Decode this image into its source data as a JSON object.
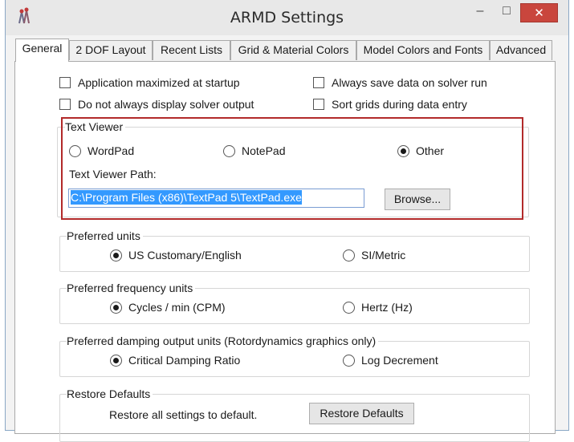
{
  "window": {
    "title": "ARMD Settings",
    "minimize_glyph": "–",
    "maximize_glyph": "□",
    "close_glyph": "✕"
  },
  "tabs": [
    {
      "label": "General",
      "active": true
    },
    {
      "label": "2 DOF Layout",
      "active": false
    },
    {
      "label": "Recent Lists",
      "active": false
    },
    {
      "label": "Grid & Material Colors",
      "active": false
    },
    {
      "label": "Model Colors and Fonts",
      "active": false
    },
    {
      "label": "Advanced",
      "active": false
    }
  ],
  "options": {
    "app_maximized": {
      "label": "Application maximized at startup",
      "checked": false
    },
    "always_save": {
      "label": "Always save data on solver run",
      "checked": false
    },
    "no_display_output": {
      "label": "Do not always display solver output",
      "checked": false
    },
    "sort_grids": {
      "label": "Sort grids during data entry",
      "checked": false
    }
  },
  "text_viewer": {
    "title": "Text Viewer",
    "options": [
      "WordPad",
      "NotePad",
      "Other"
    ],
    "selected": "Other",
    "path_label": "Text Viewer Path:",
    "path_value": "C:\\Program Files (x86)\\TextPad 5\\TextPad.exe",
    "browse_label": "Browse..."
  },
  "preferred_units": {
    "title": "Preferred units",
    "options": [
      "US Customary/English",
      "SI/Metric"
    ],
    "selected": "US Customary/English"
  },
  "frequency_units": {
    "title": "Preferred frequency units",
    "options": [
      "Cycles / min (CPM)",
      "Hertz (Hz)"
    ],
    "selected": "Cycles / min (CPM)"
  },
  "damping_units": {
    "title": "Preferred damping output units (Rotordynamics graphics only)",
    "options": [
      "Critical Damping Ratio",
      "Log Decrement"
    ],
    "selected": "Critical Damping Ratio"
  },
  "restore": {
    "title": "Restore Defaults",
    "description": "Restore all settings to default.",
    "button_label": "Restore Defaults"
  },
  "colors": {
    "close_button": "#c9463d",
    "highlight_border": "#b22a2a",
    "selection": "#3399ff"
  }
}
